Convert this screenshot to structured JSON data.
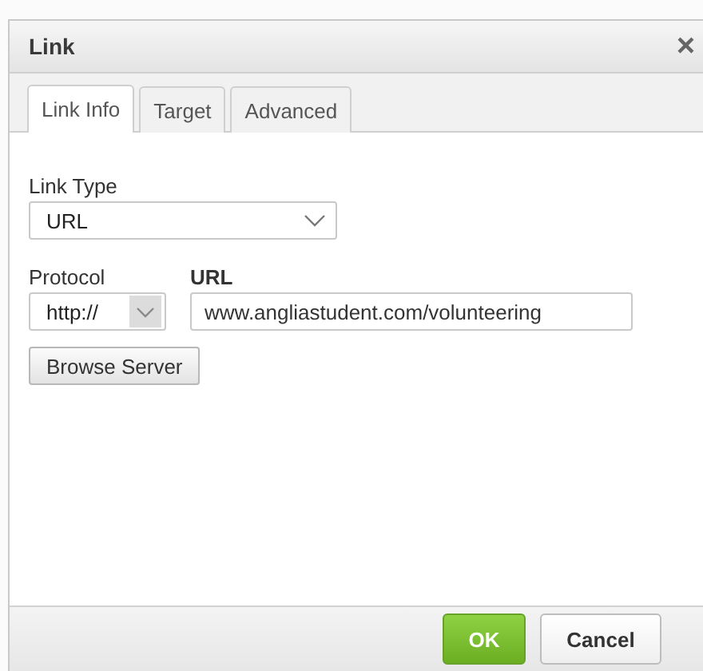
{
  "dialog": {
    "title": "Link",
    "close": "×"
  },
  "tabs": [
    {
      "label": "Link Info",
      "selected": true
    },
    {
      "label": "Target",
      "selected": false
    },
    {
      "label": "Advanced",
      "selected": false
    }
  ],
  "link_type": {
    "label": "Link Type",
    "value": "URL"
  },
  "protocol": {
    "label": "Protocol",
    "value": "http://"
  },
  "url": {
    "label": "URL",
    "value": "www.angliastudent.com/volunteering"
  },
  "browse_button": "Browse Server",
  "buttons": [
    {
      "label": "OK",
      "kind": "primary"
    },
    {
      "label": "Cancel",
      "kind": "secondary"
    }
  ]
}
